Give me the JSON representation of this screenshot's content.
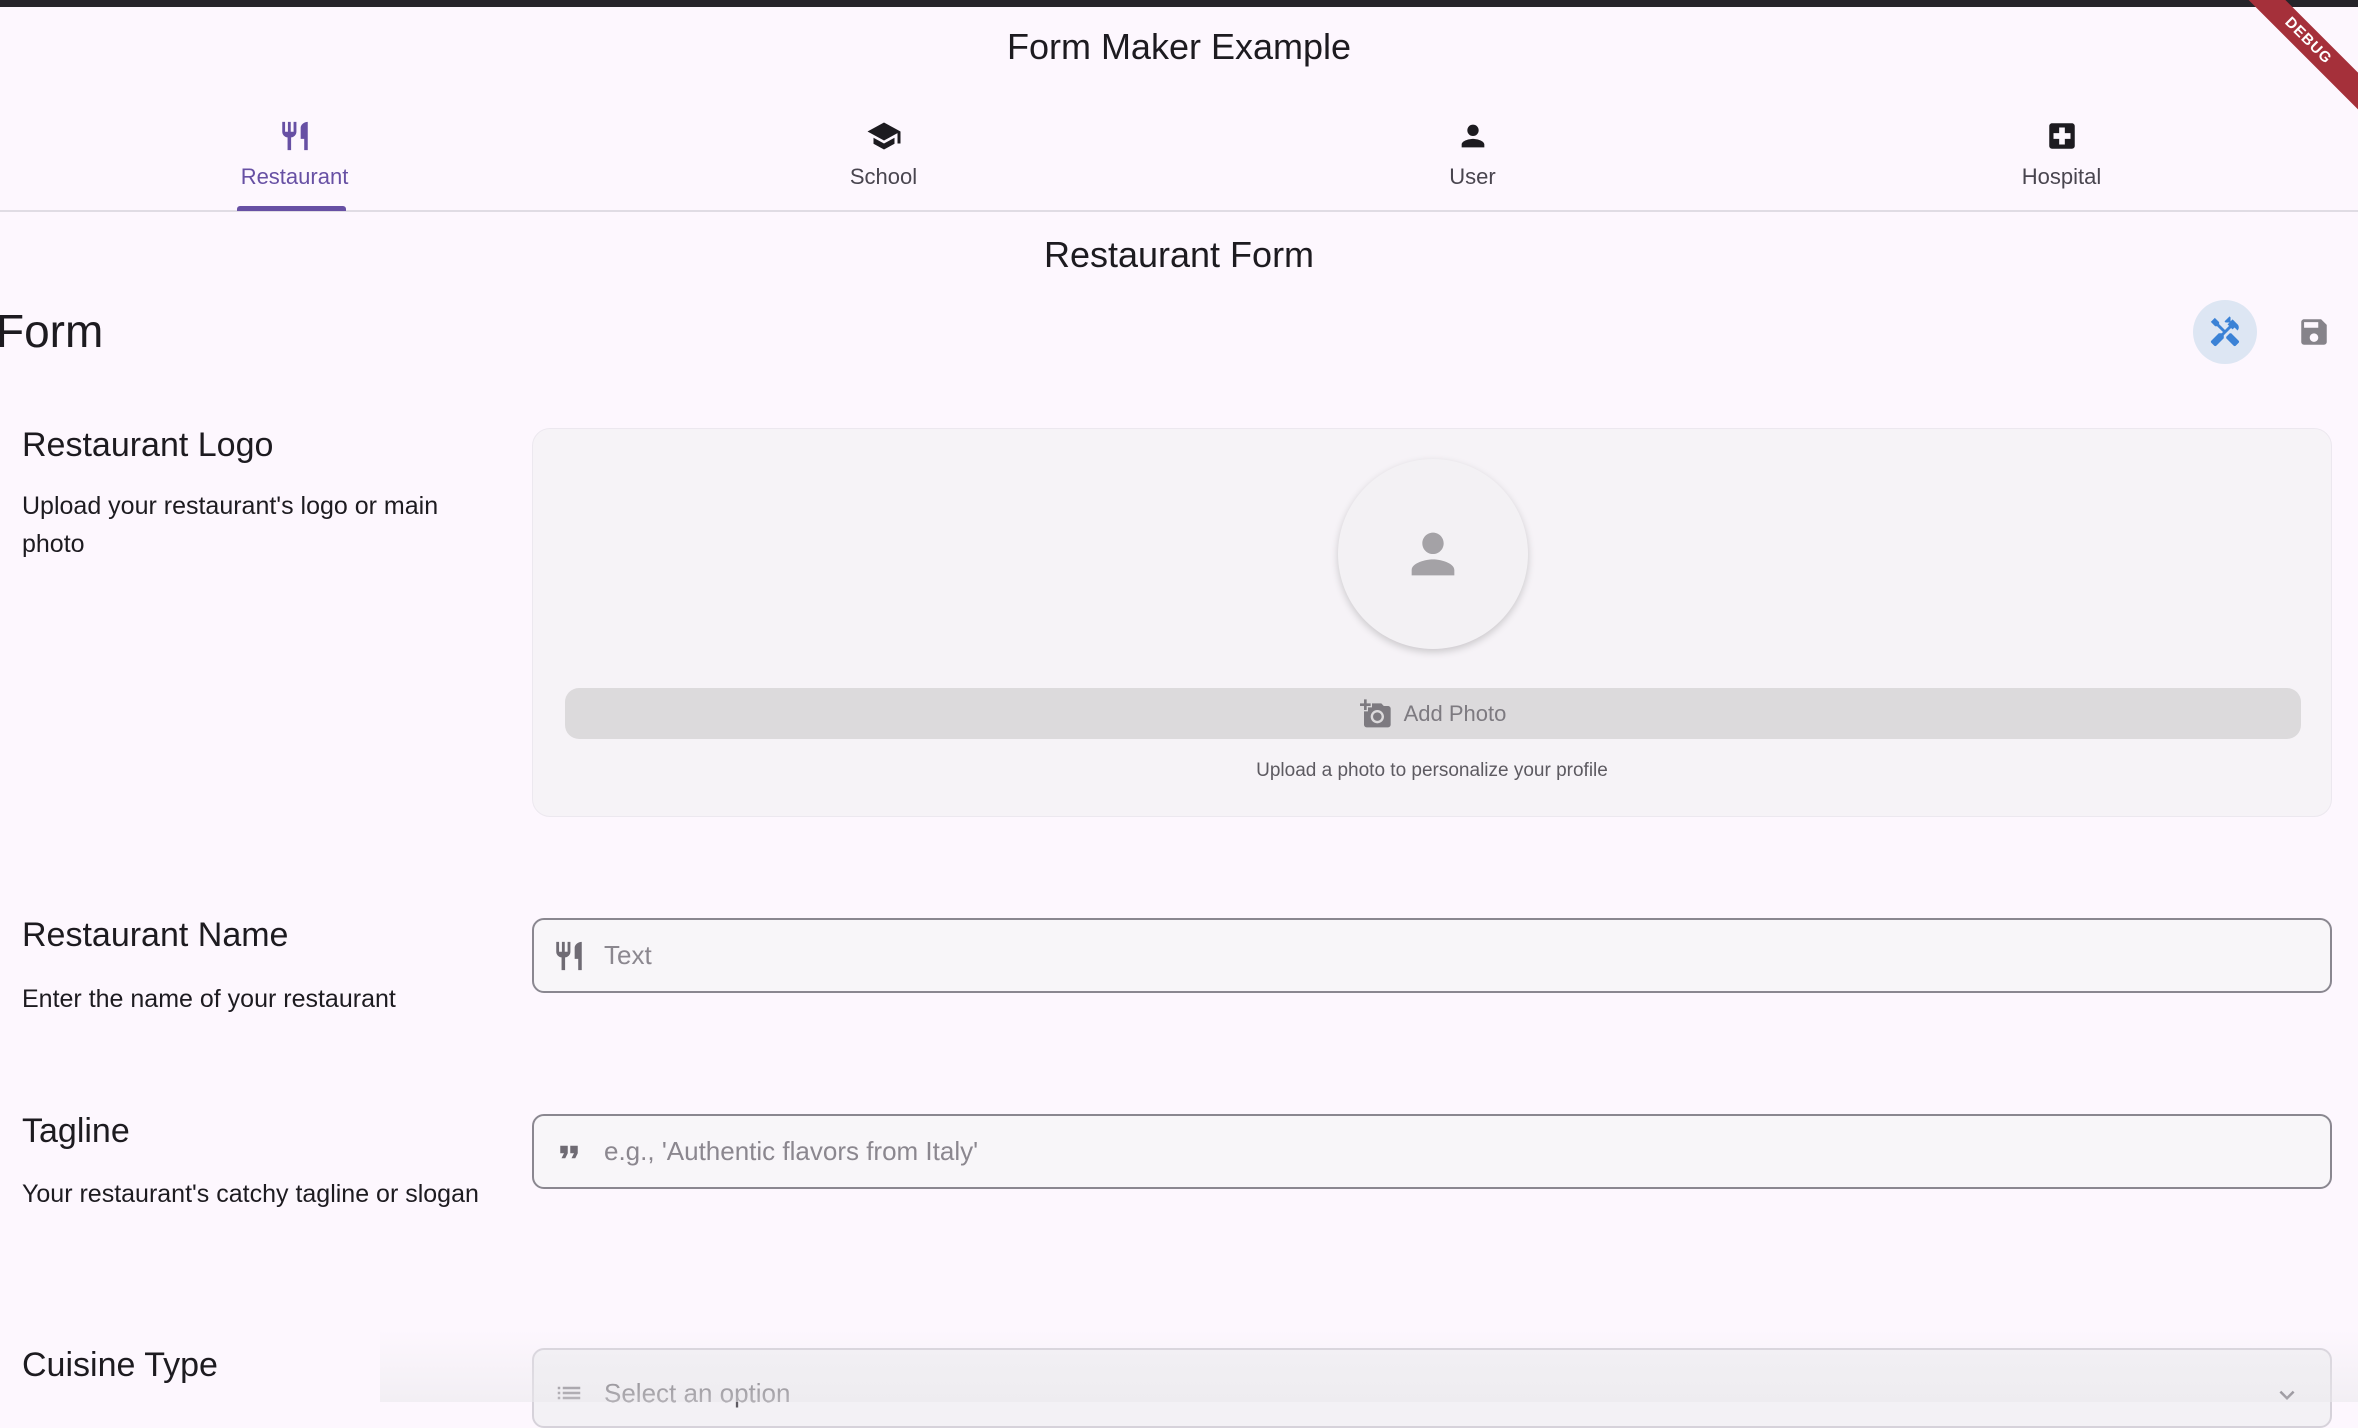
{
  "app": {
    "title": "Form Maker Example",
    "debug_banner": "DEBUG"
  },
  "tabs": [
    {
      "label": "Restaurant",
      "icon": "restaurant-icon",
      "active": true
    },
    {
      "label": "School",
      "icon": "school-icon",
      "active": false
    },
    {
      "label": "User",
      "icon": "person-icon",
      "active": false
    },
    {
      "label": "Hospital",
      "icon": "hospital-icon",
      "active": false
    }
  ],
  "form": {
    "title": "Restaurant Form",
    "section_heading": "Form",
    "actions": {
      "tools_icon": "design-tools-icon",
      "save_icon": "save-icon"
    }
  },
  "fields": {
    "logo": {
      "label": "Restaurant Logo",
      "description": "Upload your restaurant's logo or main photo",
      "button": "Add Photo",
      "hint": "Upload a photo to personalize your profile"
    },
    "name": {
      "label": "Restaurant Name",
      "description": "Enter the name of your restaurant",
      "placeholder": "Text",
      "icon": "restaurant-icon"
    },
    "tagline": {
      "label": "Tagline",
      "description": "Your restaurant's catchy tagline or slogan",
      "placeholder": "e.g., 'Authentic flavors from Italy'",
      "icon": "quote-icon"
    },
    "cuisine": {
      "label": "Cuisine Type",
      "placeholder": "Select an option",
      "icon": "list-icon"
    }
  },
  "colors": {
    "accent": "#6750a4",
    "background": "#fdf7fe",
    "tools_active": "#3b82d6"
  }
}
